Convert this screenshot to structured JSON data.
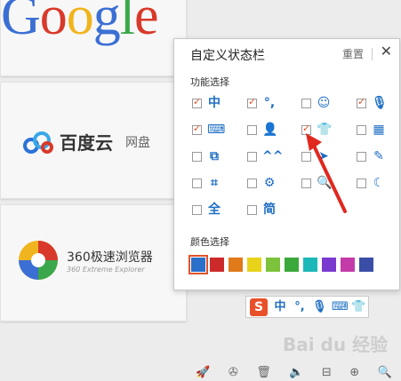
{
  "tiles": {
    "google": "Google",
    "baidu_name": "百度云",
    "baidu_pan": "网盘",
    "b360_name": "360极速浏览器",
    "b360_sub": "360 Extreme Explorer"
  },
  "panel": {
    "title": "自定义状态栏",
    "reset": "重置",
    "close": "✕",
    "func_label": "功能选择",
    "color_label": "颜色选择"
  },
  "options": [
    {
      "icon": "中",
      "checked": true
    },
    {
      "icon": "°,",
      "checked": true
    },
    {
      "icon": "☺",
      "checked": false
    },
    {
      "icon": "🎙",
      "checked": true
    },
    {
      "icon": "⌨",
      "checked": true
    },
    {
      "icon": "👤",
      "checked": false
    },
    {
      "icon": "👕",
      "checked": true
    },
    {
      "icon": "▦",
      "checked": false
    },
    {
      "icon": "⧉",
      "checked": false
    },
    {
      "icon": "^^",
      "checked": false
    },
    {
      "icon": "➤",
      "checked": false
    },
    {
      "icon": "✎",
      "checked": false
    },
    {
      "icon": "⌗",
      "checked": false
    },
    {
      "icon": "⚙",
      "checked": false
    },
    {
      "icon": "🔍",
      "checked": false
    },
    {
      "icon": "☾",
      "checked": false
    },
    {
      "icon": "全",
      "checked": false
    },
    {
      "icon": "简",
      "checked": false
    }
  ],
  "colors": [
    "#2a6fc9",
    "#cc2a2a",
    "#e07a1a",
    "#e8d21a",
    "#7cc23a",
    "#3aa83a",
    "#1ab8b8",
    "#7a3ad0",
    "#c43aa8",
    "#3a4ea8"
  ],
  "selected_color": 0,
  "imebar": {
    "logo": "S",
    "items": [
      "中",
      "°,",
      "🎙",
      "⌨",
      "👕"
    ]
  },
  "toolbar_icons": [
    "🚀",
    "✇",
    "🗑",
    "🔈",
    "⊟",
    "⊕",
    "🔍"
  ],
  "watermark": "Bai du 经验"
}
